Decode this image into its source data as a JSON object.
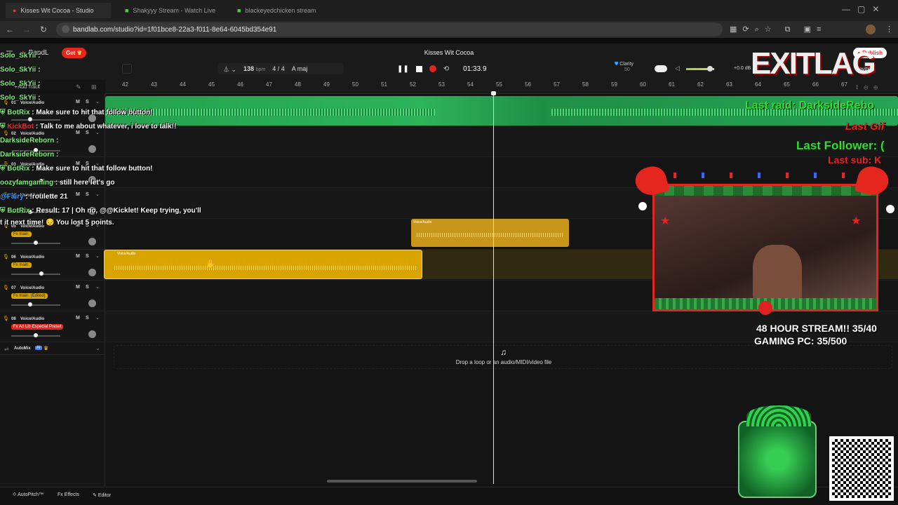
{
  "browser": {
    "tabs": [
      "Kisses Wit Cocoa - Studio",
      "Shakyyy Stream - Watch Live",
      "blackeyedchicken stream"
    ],
    "url": "bandlab.com/studio?id=1f01bce8-22a3-f011-8e64-6045bd354e91"
  },
  "studio": {
    "logo": "BandL",
    "get_label": "Get",
    "project_title": "Kisses Wit Cocoa",
    "add_track": "Add Track",
    "tempo": "138",
    "tempo_unit": "bpm",
    "time_sig": "4 / 4",
    "key": "A maj",
    "time": "01:33.9",
    "clarity_label": "Clarity",
    "clarity_value": "50",
    "volume_db": "+0.0 dB",
    "publish": "Publish",
    "invite": "Invite",
    "ruler": [
      "42",
      "43",
      "44",
      "45",
      "46",
      "47",
      "48",
      "49",
      "50",
      "51",
      "52",
      "53",
      "54",
      "55",
      "56",
      "57",
      "58",
      "59",
      "60",
      "61",
      "62",
      "63",
      "64",
      "65",
      "66",
      "67"
    ],
    "tracks": [
      {
        "num": "01",
        "name": "Voice/Audio",
        "fx": ""
      },
      {
        "num": "02",
        "name": "Voice/Audio",
        "fx": ""
      },
      {
        "num": "03",
        "name": "Voice/Audio",
        "fx": ""
      },
      {
        "num": "04",
        "name": "Voice/Audio",
        "fx": ""
      },
      {
        "num": "05",
        "name": "Voice/Audio",
        "fx": "Fx main."
      },
      {
        "num": "06",
        "name": "Voice/Audio",
        "fx": "Fx main."
      },
      {
        "num": "07",
        "name": "Voice/Audio",
        "fx": "Fx main. (Edited)"
      },
      {
        "num": "08",
        "name": "Voice/Audio",
        "fx": "Fx Ad Lib Especial Preset"
      }
    ],
    "clip_label": "Voice/Audio",
    "mute": "M",
    "solo": "S",
    "automix": "AutoMix",
    "automix_ai": "AI",
    "drop_hint": "Drop a loop or an audio/MIDI/video file",
    "bottom": {
      "autopitch": "AutoPitch™",
      "effects": "Effects",
      "editor": "Editor"
    }
  },
  "chat": [
    {
      "name": "Solo_SkYii",
      "sep": " :",
      "msg": "",
      "color": "g"
    },
    {
      "name": "Solo_SkYii",
      "sep": " :",
      "msg": "",
      "color": "g"
    },
    {
      "name": "Solo_SkYii",
      "sep": " :",
      "msg": "",
      "color": "g"
    },
    {
      "name": "Solo_SkYii",
      "sep": " :",
      "msg": "",
      "color": "g"
    },
    {
      "name": "BotRix",
      "sep": " :",
      "msg": " Make sure to hit that follow button!",
      "color": "g"
    },
    {
      "name": "KickBot",
      "sep": " :",
      "msg": " Talk to me about whatever, i love to talk!!",
      "color": "r"
    },
    {
      "name": "DarksideReborn",
      "sep": " :",
      "msg": "",
      "color": "g"
    },
    {
      "name": "DarksideReborn",
      "sep": " :",
      "msg": "",
      "color": "g"
    },
    {
      "name": "BotRix",
      "sep": " :",
      "msg": " Make sure to hit that follow button!",
      "color": "g"
    },
    {
      "name": "oozyfamgaming",
      "sep": " :",
      "msg": " still here let's go",
      "color": "g"
    },
    {
      "name": "@Fairy",
      "sep": " :",
      "msg": " !roulette 21",
      "color": "b"
    },
    {
      "name": "BotRix",
      "sep": " :",
      "msg": " Result: 17 | Oh no, @@Kicklet! Keep trying, you'll",
      "color": "g"
    },
    {
      "name": "",
      "sep": "",
      "msg": "t it next time! 😔 You lost 5 points.",
      "color": "g"
    }
  ],
  "overlay": {
    "last_raid": "Last raid: DarksideRebo",
    "last_gift": "Last Gif",
    "last_follower": "Last Follower: (",
    "last_sub": "Last sub: K",
    "stream_goal": "48 HOUR STREAM!! 35/40",
    "pc_goal": "GAMING PC: 35/500",
    "sponsor": "EXITLAG"
  },
  "colors": {
    "green_clip": "#26a355",
    "yellow_clip": "#d9a300",
    "accent_red": "#e5261f"
  }
}
